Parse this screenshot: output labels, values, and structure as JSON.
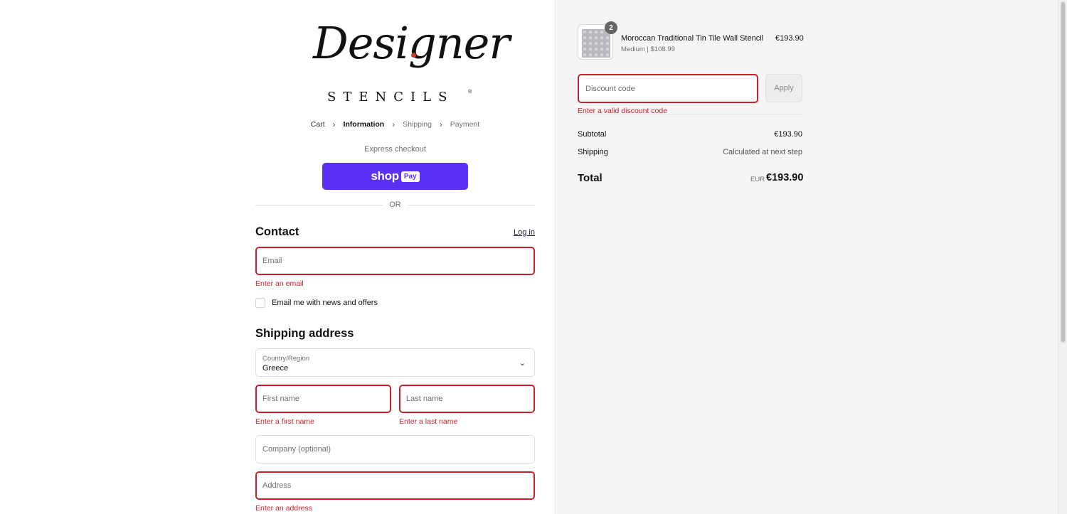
{
  "brand": {
    "logo_script": "Designer",
    "logo_sub": "STENCILS",
    "logo_reg": "®"
  },
  "breadcrumb": {
    "items": [
      "Cart",
      "Information",
      "Shipping",
      "Payment"
    ],
    "current": "Information"
  },
  "express": {
    "label": "Express checkout",
    "shop_pay_shop": "shop",
    "shop_pay_pay": "Pay",
    "or_label": "OR"
  },
  "contact": {
    "heading": "Contact",
    "login_link": "Log in",
    "email_placeholder": "Email",
    "email_error": "Enter an email",
    "newsletter_label": "Email me with news and offers"
  },
  "shipping": {
    "heading": "Shipping address",
    "country_label": "Country/Region",
    "country_value": "Greece",
    "first_name_placeholder": "First name",
    "first_name_error": "Enter a first name",
    "last_name_placeholder": "Last name",
    "last_name_error": "Enter a last name",
    "company_placeholder": "Company (optional)",
    "address_placeholder": "Address",
    "address_error": "Enter an address"
  },
  "order": {
    "quantity": "2",
    "product_name": "Moroccan Traditional Tin Tile Wall Stencil",
    "product_variant": "Medium | $108.99",
    "product_price": "€193.90",
    "discount_placeholder": "Discount code",
    "apply_label": "Apply",
    "discount_error": "Enter a valid discount code",
    "subtotal_label": "Subtotal",
    "subtotal_value": "€193.90",
    "shipping_label": "Shipping",
    "shipping_value": "Calculated at next step",
    "total_label": "Total",
    "total_currency": "EUR",
    "total_value": "€193.90"
  },
  "colors": {
    "shop_pay": "#5a31f4",
    "error": "#c8232c",
    "summary_bg": "#f5f5f5"
  }
}
